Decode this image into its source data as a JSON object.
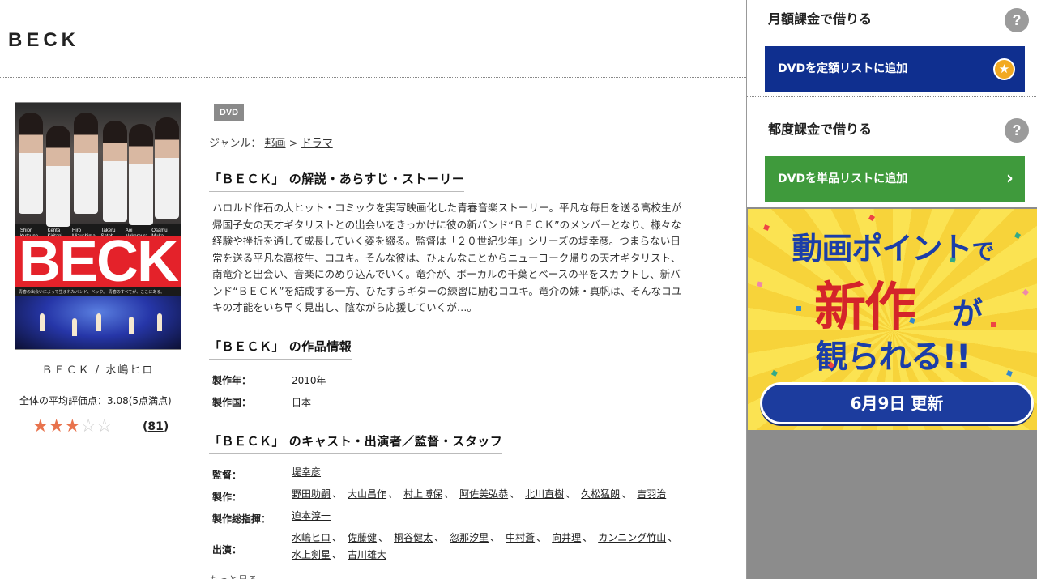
{
  "header": {
    "title": "BECK"
  },
  "poster": {
    "names": [
      "Shiori Kutsuna",
      "Kenta Kiritani",
      "Hiro Mizushima",
      "Takeru Satoh",
      "Aoi Nakamura",
      "Osamu Mukai"
    ],
    "logo": "BECK",
    "tagline": "青春の出会いによって生まれたバンド、ベック。 青春のすべてが、ここにある。",
    "caption": "ＢＥＣＫ / 水嶋ヒロ"
  },
  "rating": {
    "text": "全体の平均評価点：3.08(5点満点)",
    "stars_filled": 3,
    "stars_total": 5,
    "review_count": "81"
  },
  "product": {
    "media_badge": "DVD",
    "genre_label": "ジャンル：",
    "genre_parent": "邦画",
    "genre_sep": ">",
    "genre_child": "ドラマ"
  },
  "sections": {
    "synopsis_heading": "「ＢＥＣＫ」 の解説・あらすじ・ストーリー",
    "synopsis": "ハロルド作石の大ヒット・コミックを実写映画化した青春音楽ストーリー。平凡な毎日を送る高校生が帰国子女の天才ギタリストとの出会いをきっかけに彼の新バンド“ＢＥＣＫ”のメンバーとなり、様々な経験や挫折を通して成長していく姿を綴る。監督は「２０世紀少年」シリーズの堤幸彦。つまらない日常を送る平凡な高校生、コユキ。そんな彼は、ひょんなことからニューヨーク帰りの天才ギタリスト、南竜介と出会い、音楽にのめり込んでいく。竜介が、ボーカルの千葉とベースの平をスカウトし、新バンド“ＢＥＣＫ”を結成する一方、ひたすらギターの練習に励むコユキ。竜介の妹・真帆は、そんなコユキの才能をいち早く見出し、陰ながら応援していくが…。",
    "info_heading": "「ＢＥＣＫ」 の作品情報",
    "info": {
      "year_label": "製作年：",
      "year": "2010年",
      "country_label": "製作国：",
      "country": "日本"
    },
    "cast_heading": "「ＢＥＣＫ」 のキャスト・出演者／監督・スタッフ",
    "cast": {
      "director_label": "監督：",
      "directors": [
        "堤幸彦"
      ],
      "producer_label": "製作：",
      "producers": [
        "野田助嗣",
        "大山昌作",
        "村上博保",
        "阿佐美弘恭",
        "北川直樹",
        "久松猛朗",
        "吉羽治"
      ],
      "exec_label": "製作総指揮：",
      "execs": [
        "迫本淳一"
      ],
      "actors_label": "出演：",
      "actors": [
        "水嶋ヒロ",
        "佐藤健",
        "桐谷健太",
        "忽那汐里",
        "中村蒼",
        "向井理",
        "カンニング竹山",
        "水上剣星",
        "古川雄大"
      ]
    },
    "more": "もっと見る"
  },
  "sidebar": {
    "monthly_heading": "月額課金で借りる",
    "monthly_button": "DVDを定額リストに追加",
    "single_heading": "都度課金で借りる",
    "single_button": "DVDを単品リストに追加",
    "help": "?",
    "banner": {
      "line1a": "動画ポイント",
      "line1b": "で",
      "line2a": "新作",
      "line2b": "が",
      "line3": "観られる!!",
      "date": "6月9日 更新"
    }
  },
  "colors": {
    "monthly_button": "#0f2f8f",
    "single_button": "#3f9a3c",
    "star_on": "#e8734d",
    "star_off": "#cccccc",
    "banner_bg": "#fbe352",
    "banner_red": "#d4242a",
    "banner_blue": "#1b3ea8"
  },
  "icons": {
    "help": "question-circle-icon",
    "star_badge": "star-badge-icon",
    "chevron": "chevron-right-icon",
    "rating_star": "star-icon"
  }
}
